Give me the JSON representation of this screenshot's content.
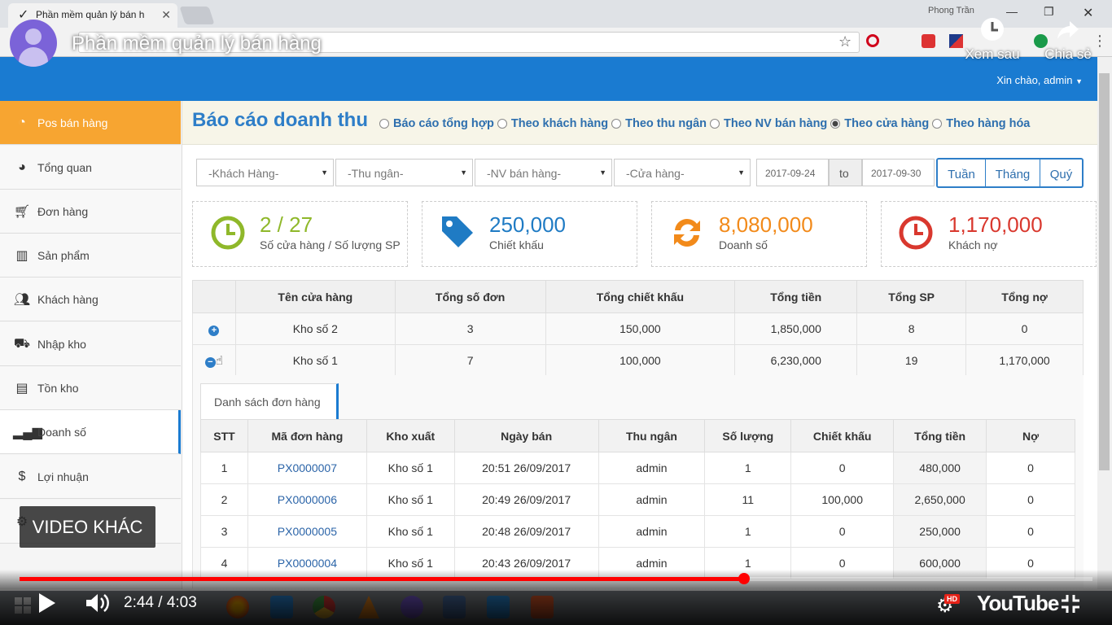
{
  "browser": {
    "tab_title": "Phần mềm quản lý bán h",
    "user_name": "Phong Trần"
  },
  "video": {
    "title": "Phần mềm quản lý bán hàng",
    "watch_later": "Xem sau",
    "share": "Chia sẻ",
    "other_videos": "VIDEO KHÁC",
    "time_current": "2:44",
    "time_total": "4:03",
    "progress": 0.675,
    "brand": "YouTube",
    "hd_badge": "HD"
  },
  "header": {
    "greeting": "Xin chào, admin"
  },
  "sidebar": {
    "items": [
      {
        "label": "Pos bán hàng",
        "icon": "dashboard-icon"
      },
      {
        "label": "Tổng quan",
        "icon": "gauge-icon"
      },
      {
        "label": "Đơn hàng",
        "icon": "cart-icon"
      },
      {
        "label": "Sản phẩm",
        "icon": "barcode-icon"
      },
      {
        "label": "Khách hàng",
        "icon": "users-icon"
      },
      {
        "label": "Nhập kho",
        "icon": "truck-icon"
      },
      {
        "label": "Tồn kho",
        "icon": "inventory-icon"
      },
      {
        "label": "Doanh số",
        "icon": "signal-icon"
      },
      {
        "label": "Lợi nhuận",
        "icon": "dollar-icon"
      }
    ]
  },
  "report": {
    "title": "Báo cáo doanh thu",
    "modes": [
      {
        "label": "Báo cáo tổng hợp",
        "selected": false
      },
      {
        "label": "Theo khách hàng",
        "selected": false
      },
      {
        "label": "Theo thu ngân",
        "selected": false
      },
      {
        "label": "Theo NV bán hàng",
        "selected": false
      },
      {
        "label": "Theo cửa hàng",
        "selected": true
      },
      {
        "label": "Theo hàng hóa",
        "selected": false
      }
    ]
  },
  "filters": {
    "customer": "-Khách Hàng-",
    "cashier": "-Thu ngân-",
    "salesperson": "-NV bán hàng-",
    "store": "-Cửa hàng-",
    "date_from": "2017-09-24",
    "to_label": "to",
    "date_to": "2017-09-30",
    "periods": [
      "Tuần",
      "Tháng",
      "Quý"
    ]
  },
  "stats": [
    {
      "value": "2 / 27",
      "label": "Số cửa hàng / Số lượng SP",
      "color": "#8fb82a",
      "icon": "clock-icon"
    },
    {
      "value": "250,000",
      "label": "Chiết khấu",
      "color": "#1f7bc4",
      "icon": "tag-icon"
    },
    {
      "value": "8,080,000",
      "label": "Doanh số",
      "color": "#f28a1a",
      "icon": "refresh-icon"
    },
    {
      "value": "1,170,000",
      "label": "Khách nợ",
      "color": "#d9382e",
      "icon": "clock-icon"
    }
  ],
  "store_table": {
    "headers": [
      "",
      "Tên cửa hàng",
      "Tổng số đơn",
      "Tổng chiết khấu",
      "Tổng tiền",
      "Tổng SP",
      "Tổng nợ"
    ],
    "rows": [
      [
        "Kho số 2",
        "3",
        "150,000",
        "1,850,000",
        "8",
        "0"
      ],
      [
        "Kho số 1",
        "7",
        "100,000",
        "6,230,000",
        "19",
        "1,170,000"
      ]
    ]
  },
  "orders": {
    "tab_label": "Danh sách đơn hàng",
    "headers": [
      "STT",
      "Mã đơn hàng",
      "Kho xuất",
      "Ngày bán",
      "Thu ngân",
      "Số lượng",
      "Chiết khấu",
      "Tổng tiền",
      "Nợ"
    ],
    "rows": [
      [
        "1",
        "PX0000007",
        "Kho số 1",
        "20:51 26/09/2017",
        "admin",
        "1",
        "0",
        "480,000",
        "0"
      ],
      [
        "2",
        "PX0000006",
        "Kho số 1",
        "20:49 26/09/2017",
        "admin",
        "11",
        "100,000",
        "2,650,000",
        "0"
      ],
      [
        "3",
        "PX0000005",
        "Kho số 1",
        "20:48 26/09/2017",
        "admin",
        "1",
        "0",
        "250,000",
        "0"
      ],
      [
        "4",
        "PX0000004",
        "Kho số 1",
        "20:43 26/09/2017",
        "admin",
        "1",
        "0",
        "600,000",
        "0"
      ]
    ]
  },
  "colors": {
    "header_blue": "#1a7bd1",
    "active_orange": "#f7a531",
    "progress_red": "#ff0000"
  }
}
